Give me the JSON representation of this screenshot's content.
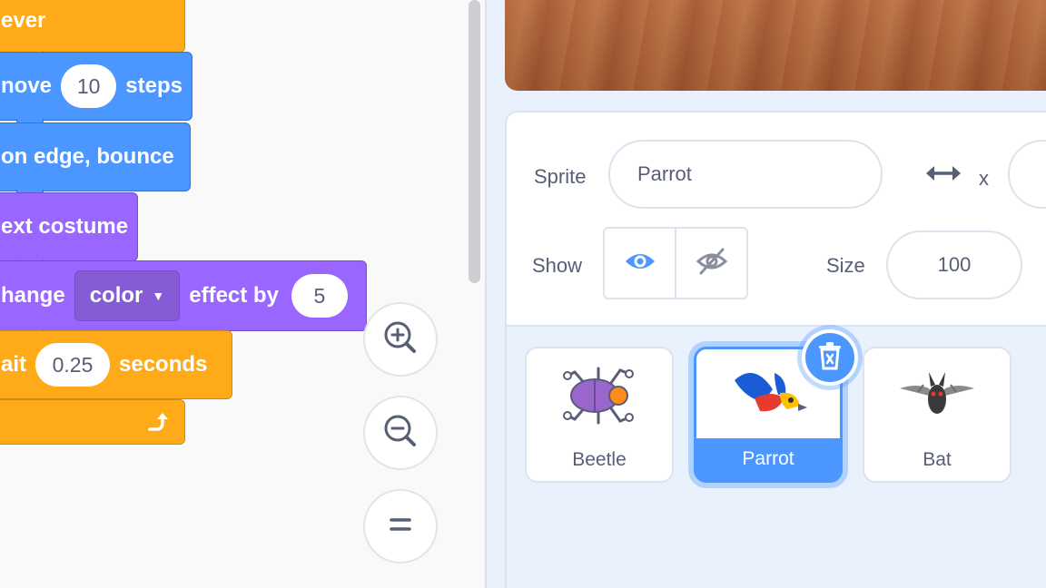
{
  "blocks": {
    "forever_label": "ever",
    "move_prefix": "nove",
    "move_steps_value": "10",
    "move_suffix": "steps",
    "bounce_label": "on edge, bounce",
    "costume_label": "ext costume",
    "change_prefix": "hange",
    "change_effect_option": "color",
    "change_mid": "effect by",
    "change_value": "5",
    "wait_prefix": "ait",
    "wait_value": "0.25",
    "wait_suffix": "seconds"
  },
  "zoom_controls": [
    "zoom-in-icon",
    "zoom-out-icon",
    "zoom-reset-icon"
  ],
  "sprite_info": {
    "sprite_label": "Sprite",
    "sprite_name": "Parrot",
    "x_label": "x",
    "show_label": "Show",
    "size_label": "Size",
    "size_value": "100"
  },
  "sprites": [
    {
      "name": "Beetle",
      "selected": false
    },
    {
      "name": "Parrot",
      "selected": true
    },
    {
      "name": "Bat",
      "selected": false
    }
  ],
  "colors": {
    "events_orange": "#ffab19",
    "motion_blue": "#4c97ff",
    "looks_purple": "#9966ff",
    "selection_blue": "#4c97ff"
  }
}
